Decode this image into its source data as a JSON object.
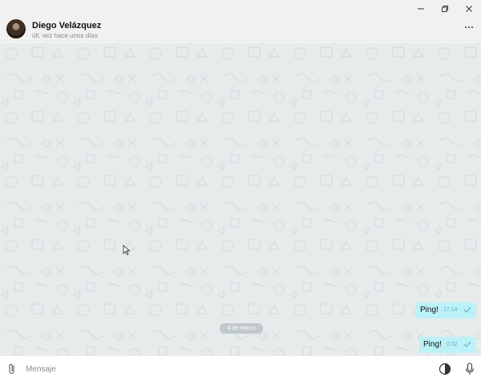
{
  "window": {
    "controls": [
      {
        "name": "minimize",
        "icon": "minimize-icon"
      },
      {
        "name": "restore",
        "icon": "restore-icon"
      },
      {
        "name": "close",
        "icon": "close-icon"
      }
    ]
  },
  "header": {
    "contact_name": "Diego Velázquez",
    "status": "últ. vez hace unos días",
    "more_icon": "more-horizontal-icon"
  },
  "chat": {
    "date_separator": "4 de marzo",
    "messages": [
      {
        "text": "Ping!",
        "time": "17:14",
        "status_icon": "check-icon",
        "outgoing": true
      },
      {
        "text": "Ping!",
        "time": "0:32",
        "status_icon": "check-icon",
        "outgoing": true
      }
    ]
  },
  "composer": {
    "placeholder": "Mensaje",
    "value": "",
    "attach_icon": "paperclip-icon",
    "emoji_icon": "emoji-icon",
    "mic_icon": "microphone-icon"
  },
  "colors": {
    "header_bg": "#f1f1f1",
    "chat_bg": "#e7ebec",
    "bubble_out": "#bdf1f8",
    "time_color": "#5bb5c5"
  }
}
